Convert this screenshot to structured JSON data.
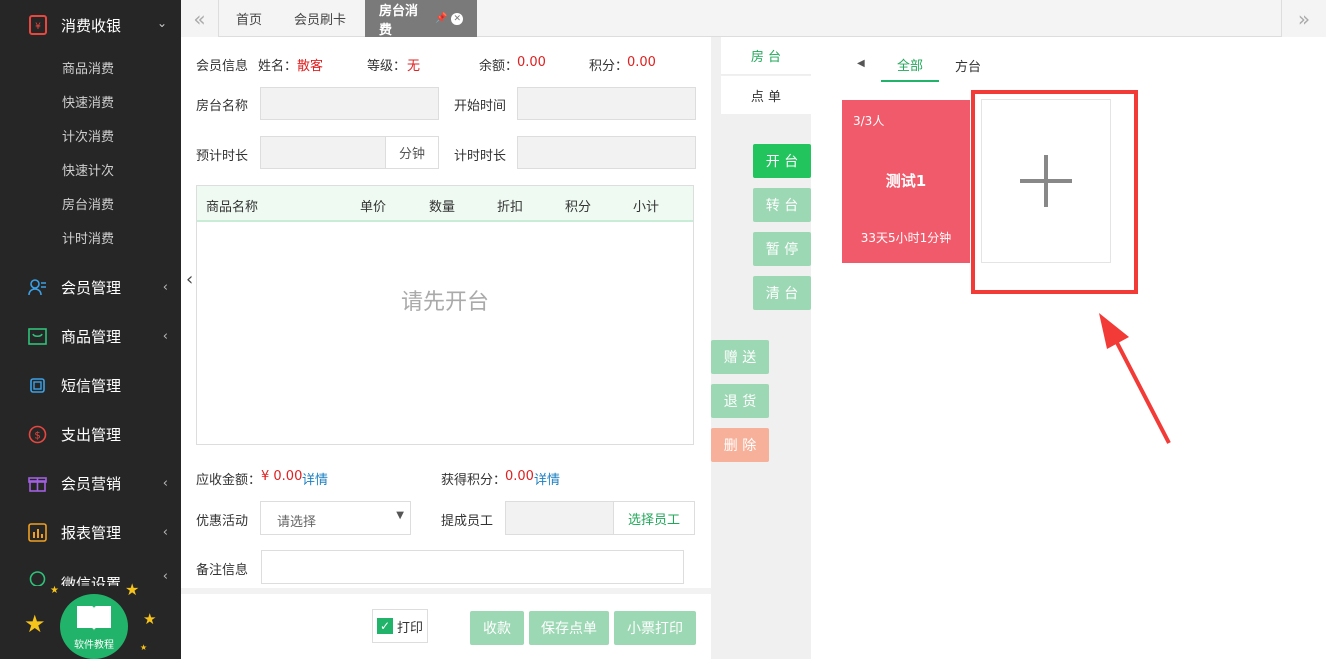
{
  "sidebar": {
    "header": "消费收银",
    "items": [
      "商品消费",
      "快速消费",
      "计次消费",
      "快速计次",
      "房台消费",
      "计时消费"
    ],
    "groups": [
      "会员管理",
      "商品管理",
      "短信管理",
      "支出管理",
      "会员营销",
      "报表管理",
      "微信设置"
    ],
    "tutorial": "软件教程"
  },
  "tabs": {
    "home": "首页",
    "card": "会员刷卡",
    "room": "房台消费"
  },
  "member": {
    "info_label": "会员信息",
    "name_label": "姓名：",
    "name": "散客",
    "level_label": "等级：",
    "level": "无",
    "balance_label": "余额：",
    "balance": "0.00",
    "points_label": "积分：",
    "points": "0.00"
  },
  "form": {
    "room_name": "房台名称",
    "start_time": "开始时间",
    "est_duration": "预计时长",
    "minute": "分钟",
    "timer": "计时时长"
  },
  "table": {
    "columns": [
      "商品名称",
      "单价",
      "数量",
      "折扣",
      "积分",
      "小计"
    ],
    "empty": "请先开台"
  },
  "summary": {
    "due_label": "应收金额：",
    "due": "¥ 0.00",
    "detail": "详情",
    "earn_label": "获得积分：",
    "earn": "0.00",
    "promo_label": "优惠活动",
    "promo_placeholder": "请选择",
    "staff_label": "提成员工",
    "choose_staff": "选择员工",
    "remark_label": "备注信息"
  },
  "footer": {
    "print": "打印",
    "pay": "收款",
    "save": "保存点单",
    "receipt": "小票打印"
  },
  "actions": {
    "open": "开 台",
    "transfer": "转 台",
    "pause": "暂 停",
    "clear": "清 台",
    "gift": "赠 送",
    "refund": "退 货",
    "delete": "删 除"
  },
  "side_tabs": {
    "room": "房 台",
    "order": "点 单"
  },
  "filters": {
    "all": "全部",
    "square": "方台"
  },
  "room_card": {
    "people": "3/3人",
    "name": "测试1",
    "duration": "33天5小时1分钟"
  },
  "colors": {
    "accent": "#22c45d",
    "room_card": "#f05a6b",
    "highlight": "#f23a36",
    "sidebar": "#262626"
  }
}
